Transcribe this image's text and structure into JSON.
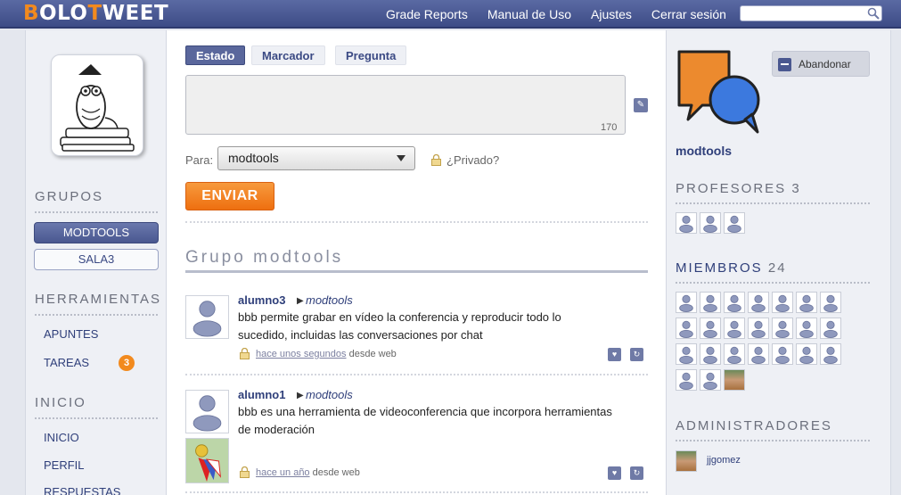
{
  "header": {
    "logo_first": "B",
    "logo_olo": "OLO",
    "logo_t": "T",
    "logo_weet": "WEET",
    "nav": [
      "Grade Reports",
      "Manual de Uso",
      "Ajustes",
      "Cerrar sesión"
    ],
    "search_placeholder": ""
  },
  "left": {
    "grupos_title": "GRUPOS",
    "groups": [
      {
        "label": "MODTOOLS",
        "active": true
      },
      {
        "label": "SALA3",
        "active": false
      }
    ],
    "herramientas_title": "HERRAMIENTAS",
    "tools": [
      {
        "label": "APUNTES"
      },
      {
        "label": "TAREAS",
        "badge": "3"
      }
    ],
    "inicio_title": "INICIO",
    "inicio_links": [
      "INICIO",
      "PERFIL",
      "RESPUESTAS"
    ]
  },
  "composer": {
    "tabs": [
      "Estado",
      "Marcador",
      "Pregunta"
    ],
    "active_tab": "Estado",
    "char_count": "170",
    "para_label": "Para:",
    "recipient": "modtools",
    "private_label": "¿Privado?",
    "send_label": "ENVIAR"
  },
  "stream": {
    "title": "Grupo modtools",
    "posts": [
      {
        "author": "alumno3",
        "group": "modtools",
        "text": "bbb permite grabar en vídeo la conferencia y reproducir todo lo sucedido, incluidas las conversaciones por chat",
        "time": "hace unos segundos",
        "source": "desde web"
      },
      {
        "author": "alumno1",
        "group": "modtools",
        "text": "bbb es una herramienta de videoconferencia que incorpora herramientas de moderación",
        "time": "hace un año",
        "source": "desde web"
      }
    ]
  },
  "right": {
    "group_name": "modtools",
    "leave_label": "Abandonar",
    "profesores_title": "PROFESORES",
    "profesores_count": "3",
    "miembros_title": "MIEMBROS",
    "miembros_count": "24",
    "admins_title": "ADMINISTRADORES",
    "admin_name": "jjgomez"
  },
  "colors": {
    "accent": "#f28a1e",
    "nav_blue": "#3d4c86",
    "link_blue": "#2f3f7a"
  }
}
